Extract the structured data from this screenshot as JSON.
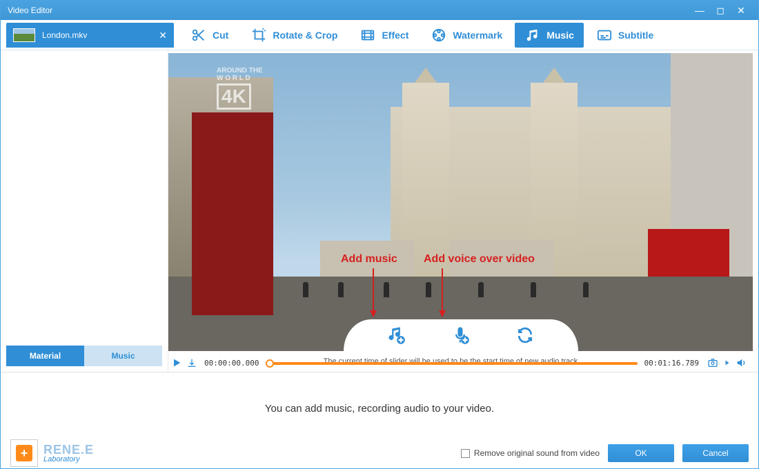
{
  "window": {
    "title": "Video Editor"
  },
  "file_tab": {
    "name": "London.mkv"
  },
  "tools": {
    "cut": "Cut",
    "rotate": "Rotate & Crop",
    "effect": "Effect",
    "watermark": "Watermark",
    "music": "Music",
    "subtitle": "Subtitle"
  },
  "sidebar_tabs": {
    "material": "Material",
    "music": "Music"
  },
  "preview": {
    "watermark_small": "AROUND THE",
    "watermark_word": "W O R L D",
    "watermark_4k": "4K"
  },
  "annotations": {
    "add_music": "Add music",
    "add_voice": "Add voice over video"
  },
  "timeline": {
    "start": "00:00:00.000",
    "end": "00:01:16.789",
    "hint": "The current time of slider will be used to be the start time of new audio track."
  },
  "footer": {
    "message": "You can add music, recording audio to your video.",
    "checkbox": "Remove original sound from video",
    "ok": "OK",
    "cancel": "Cancel"
  },
  "brand": {
    "line1": "RENE.E",
    "line2": "Laboratory"
  }
}
